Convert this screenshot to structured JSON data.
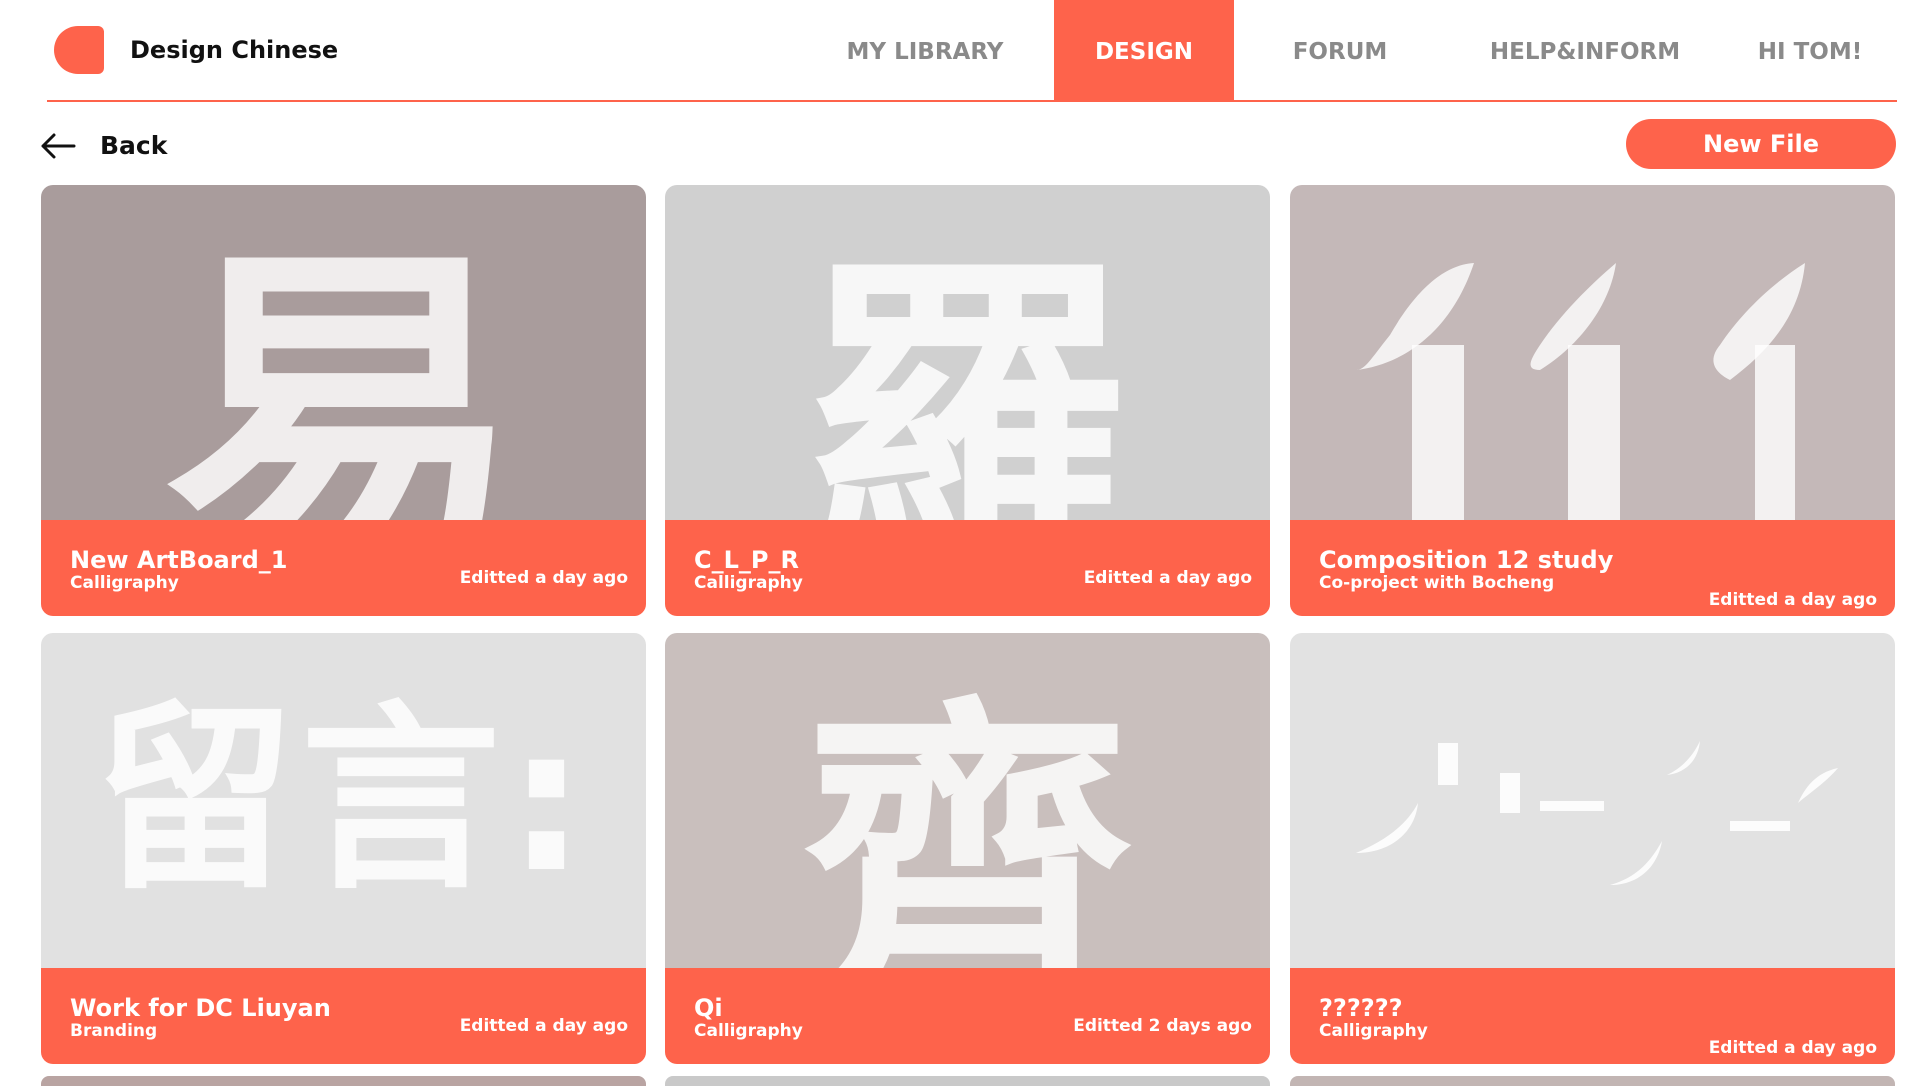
{
  "app": {
    "title": "Design Chinese"
  },
  "nav": [
    {
      "label": "MY LIBRARY",
      "active": false
    },
    {
      "label": "DESIGN",
      "active": true
    },
    {
      "label": "FORUM",
      "active": false
    },
    {
      "label": "HELP&INFORM",
      "active": false
    },
    {
      "label": "HI TOM!",
      "active": false
    }
  ],
  "toolbar": {
    "back_label": "Back",
    "new_file_label": "New File"
  },
  "colors": {
    "accent": "#fe634b"
  },
  "cards": [
    {
      "title": "New ArtBoard_1",
      "subtitle": "Calligraphy",
      "edited": "Editted a day ago",
      "glyph": "易",
      "thumb_color": "#a99c9c"
    },
    {
      "title": "C_L_P_R",
      "subtitle": "Calligraphy",
      "edited": "Editted a day ago",
      "glyph": "羅",
      "thumb_color": "#d0d0d0"
    },
    {
      "title": "Composition 12 study",
      "subtitle": "Co-project with Bocheng",
      "edited": "Editted a day ago",
      "glyph": "",
      "thumb_color": "#c4b8b8"
    },
    {
      "title": "Work for DC Liuyan",
      "subtitle": "Branding",
      "edited": "Editted a day ago",
      "glyph": "留言:",
      "thumb_color": "#e1e1e1"
    },
    {
      "title": "Qi",
      "subtitle": "Calligraphy",
      "edited": "Editted 2 days ago",
      "glyph": "齊",
      "thumb_color": "#c9bfbd"
    },
    {
      "title": "??????",
      "subtitle": "Calligraphy",
      "edited": "Editted a day ago",
      "glyph": "",
      "thumb_color": "#e2e2e2"
    }
  ],
  "peek_colors": [
    "#b9a4a2",
    "#c9c9c9",
    "#c2b5b3"
  ]
}
